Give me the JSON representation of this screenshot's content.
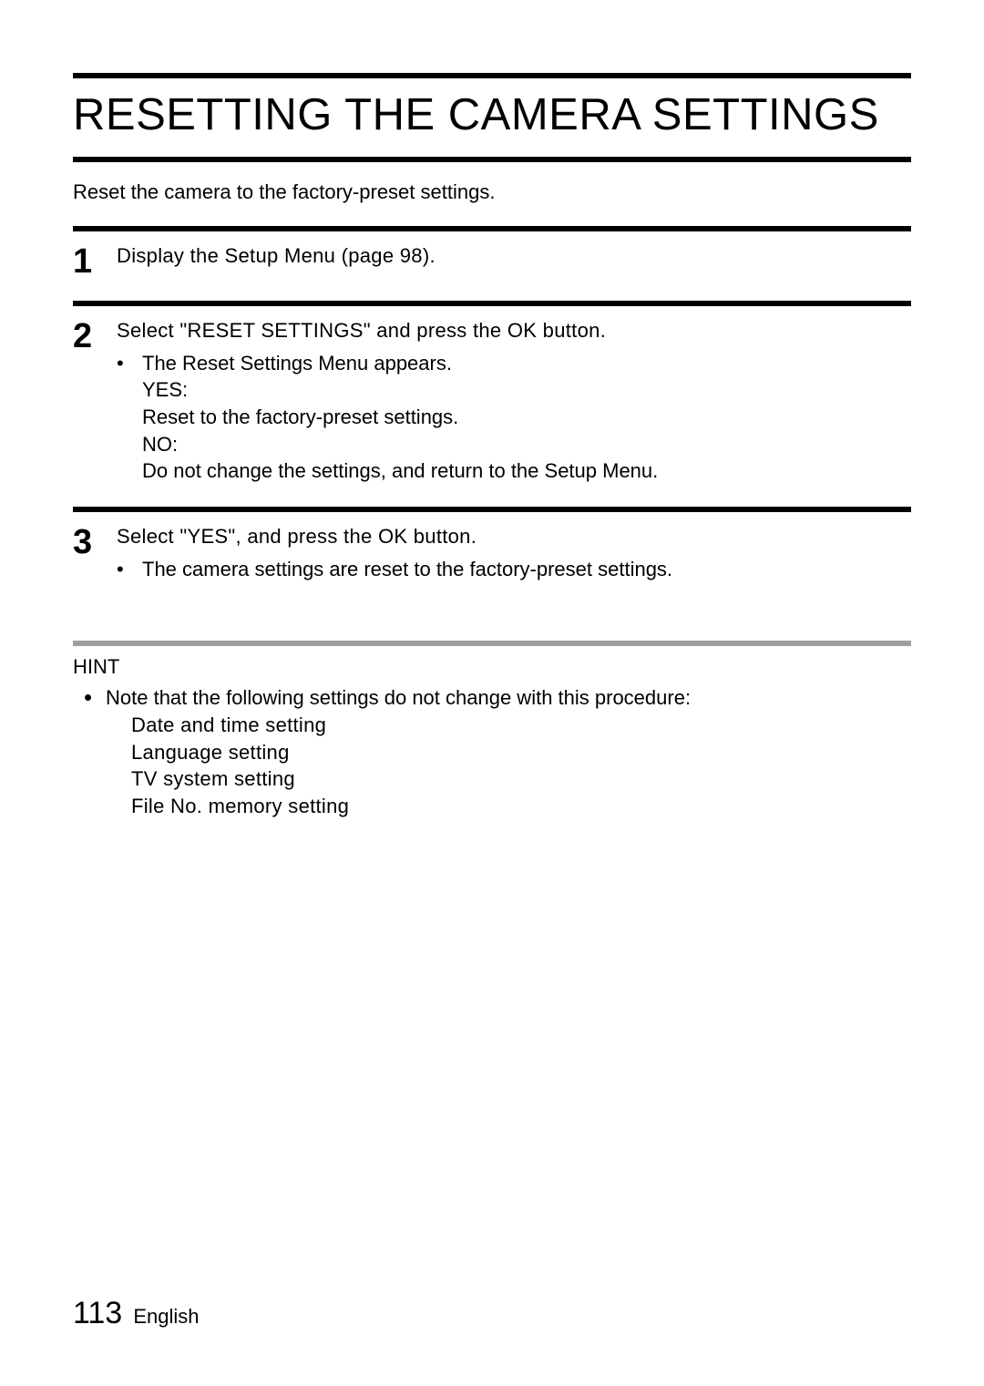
{
  "title": "RESETTING THE CAMERA SETTINGS",
  "intro": "Reset the camera to the factory-preset settings.",
  "steps": [
    {
      "num": "1",
      "main": "Display the Setup Menu (page 98).",
      "sub": []
    },
    {
      "num": "2",
      "main": "Select \"RESET SETTINGS\" and press the OK button.",
      "sub": [
        "The Reset Settings Menu appears.",
        "YES:",
        "Reset to the factory-preset settings.",
        "NO:",
        "Do not change the settings, and return to the Setup Menu."
      ]
    },
    {
      "num": "3",
      "main": "Select \"YES\", and press the OK button.",
      "sub": [
        "The camera settings are reset to the factory-preset settings."
      ]
    }
  ],
  "hint": {
    "label": "HINT",
    "lead": "Note that the following settings do not change with this procedure:",
    "items": [
      "Date and time setting",
      "Language setting",
      "TV system setting",
      "File No. memory setting"
    ]
  },
  "footer": {
    "page_number": "113",
    "language": "English"
  },
  "bullet_char": "•",
  "small_bullet_char": "•"
}
